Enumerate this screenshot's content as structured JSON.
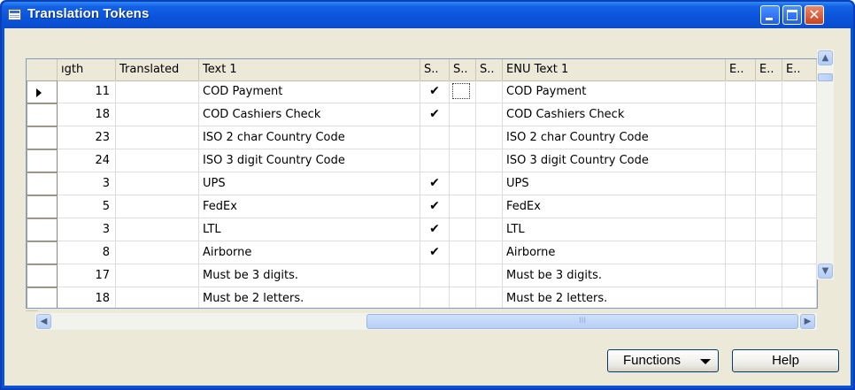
{
  "window": {
    "title": "Translation Tokens",
    "controls": {
      "minimize": "_",
      "maximize": "□",
      "close": "✕"
    }
  },
  "grid": {
    "columns": [
      "ıgth",
      "Translated",
      "Text 1",
      "S..",
      "S..",
      "S..",
      "ENU Text 1",
      "E..",
      "E..",
      "E.."
    ],
    "rows": [
      {
        "length": "11",
        "translated": "",
        "text1": "COD Payment",
        "s1": "✔",
        "s2": "",
        "s3": "",
        "enu_text1": "COD Payment"
      },
      {
        "length": "18",
        "translated": "",
        "text1": "COD Cashiers Check",
        "s1": "✔",
        "s2": "",
        "s3": "",
        "enu_text1": "COD Cashiers Check"
      },
      {
        "length": "23",
        "translated": "",
        "text1": "ISO 2 char Country Code",
        "s1": "",
        "s2": "",
        "s3": "",
        "enu_text1": "ISO 2 char Country Code"
      },
      {
        "length": "24",
        "translated": "",
        "text1": "ISO 3 digit Country Code",
        "s1": "",
        "s2": "",
        "s3": "",
        "enu_text1": "ISO 3 digit Country Code"
      },
      {
        "length": "3",
        "translated": "",
        "text1": "UPS",
        "s1": "✔",
        "s2": "",
        "s3": "",
        "enu_text1": "UPS"
      },
      {
        "length": "5",
        "translated": "",
        "text1": "FedEx",
        "s1": "✔",
        "s2": "",
        "s3": "",
        "enu_text1": "FedEx"
      },
      {
        "length": "3",
        "translated": "",
        "text1": "LTL",
        "s1": "✔",
        "s2": "",
        "s3": "",
        "enu_text1": "LTL"
      },
      {
        "length": "8",
        "translated": "",
        "text1": "Airborne",
        "s1": "✔",
        "s2": "",
        "s3": "",
        "enu_text1": "Airborne"
      },
      {
        "length": "17",
        "translated": "",
        "text1": "Must be 3 digits.",
        "s1": "",
        "s2": "",
        "s3": "",
        "enu_text1": "Must be 3 digits."
      },
      {
        "length": "18",
        "translated": "",
        "text1": "Must be 2 letters.",
        "s1": "",
        "s2": "",
        "s3": "",
        "enu_text1": "Must be 2 letters."
      }
    ],
    "scrollbar_glyphs": {
      "up": "▲",
      "down": "▼",
      "left": "◀",
      "right": "▶",
      "grip": "III"
    }
  },
  "buttons": {
    "functions": "Functions",
    "help": "Help"
  },
  "icons": {
    "window_icon": "table-window-icon",
    "row_selector": "current-row-arrow-icon"
  }
}
